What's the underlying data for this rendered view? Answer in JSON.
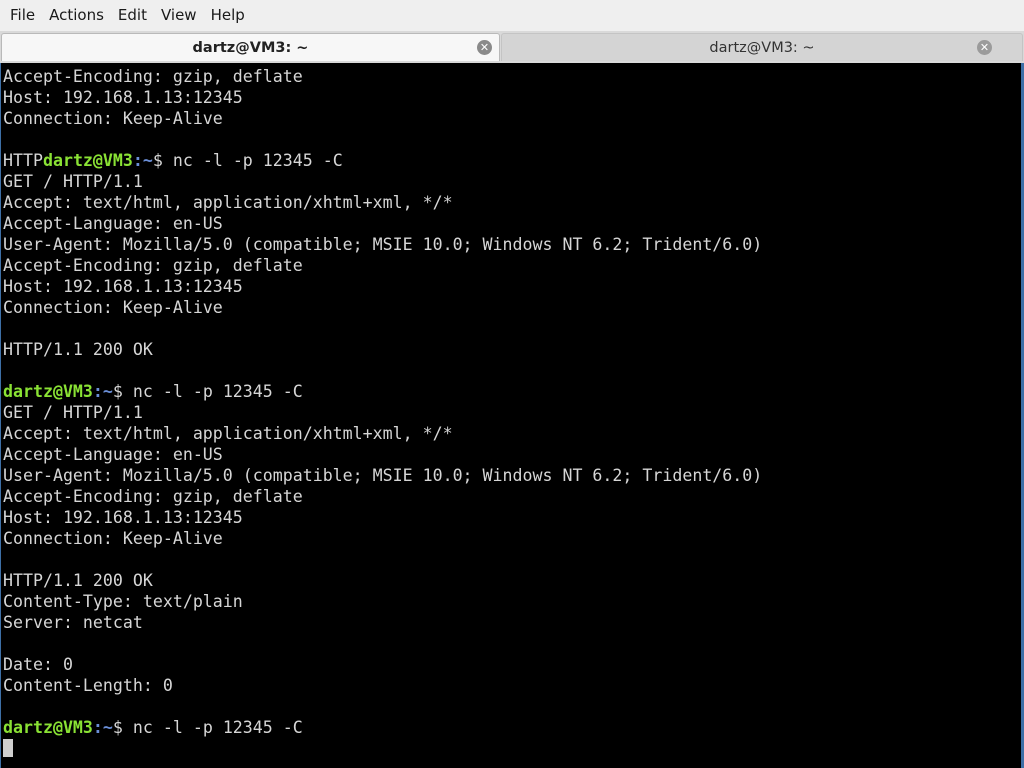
{
  "menubar": {
    "items": [
      "File",
      "Actions",
      "Edit",
      "View",
      "Help"
    ]
  },
  "tabs": [
    {
      "title": "dartz@VM3: ~",
      "close_glyph": "✕"
    },
    {
      "title": "dartz@VM3: ~",
      "close_glyph": "✕"
    }
  ],
  "terminal": {
    "prompt": {
      "user_host": "dartz@VM3",
      "separator": ":",
      "path": "~",
      "symbol": "$ "
    },
    "lines": [
      {
        "type": "text",
        "text": "Accept-Encoding: gzip, deflate"
      },
      {
        "type": "text",
        "text": "Host: 192.168.1.13:12345"
      },
      {
        "type": "text",
        "text": "Connection: Keep-Alive"
      },
      {
        "type": "text",
        "text": ""
      },
      {
        "type": "prompt",
        "prefix": "HTTP",
        "command": "nc -l -p 12345 -C"
      },
      {
        "type": "text",
        "text": "GET / HTTP/1.1"
      },
      {
        "type": "text",
        "text": "Accept: text/html, application/xhtml+xml, */*"
      },
      {
        "type": "text",
        "text": "Accept-Language: en-US"
      },
      {
        "type": "text",
        "text": "User-Agent: Mozilla/5.0 (compatible; MSIE 10.0; Windows NT 6.2; Trident/6.0)"
      },
      {
        "type": "text",
        "text": "Accept-Encoding: gzip, deflate"
      },
      {
        "type": "text",
        "text": "Host: 192.168.1.13:12345"
      },
      {
        "type": "text",
        "text": "Connection: Keep-Alive"
      },
      {
        "type": "text",
        "text": ""
      },
      {
        "type": "text",
        "text": "HTTP/1.1 200 OK"
      },
      {
        "type": "text",
        "text": ""
      },
      {
        "type": "prompt",
        "prefix": "",
        "command": "nc -l -p 12345 -C"
      },
      {
        "type": "text",
        "text": "GET / HTTP/1.1"
      },
      {
        "type": "text",
        "text": "Accept: text/html, application/xhtml+xml, */*"
      },
      {
        "type": "text",
        "text": "Accept-Language: en-US"
      },
      {
        "type": "text",
        "text": "User-Agent: Mozilla/5.0 (compatible; MSIE 10.0; Windows NT 6.2; Trident/6.0)"
      },
      {
        "type": "text",
        "text": "Accept-Encoding: gzip, deflate"
      },
      {
        "type": "text",
        "text": "Host: 192.168.1.13:12345"
      },
      {
        "type": "text",
        "text": "Connection: Keep-Alive"
      },
      {
        "type": "text",
        "text": ""
      },
      {
        "type": "text",
        "text": "HTTP/1.1 200 OK"
      },
      {
        "type": "text",
        "text": "Content-Type: text/plain"
      },
      {
        "type": "text",
        "text": "Server: netcat"
      },
      {
        "type": "text",
        "text": ""
      },
      {
        "type": "text",
        "text": "Date: 0"
      },
      {
        "type": "text",
        "text": "Content-Length: 0"
      },
      {
        "type": "text",
        "text": ""
      },
      {
        "type": "prompt",
        "prefix": "",
        "command": "nc -l -p 12345 -C"
      },
      {
        "type": "cursor"
      }
    ]
  },
  "colors": {
    "prompt_user": "#8ae234",
    "prompt_path": "#6b8fd8",
    "terminal_bg": "#000000",
    "terminal_fg": "#d6d6d6",
    "menubar_bg": "#efefef"
  }
}
